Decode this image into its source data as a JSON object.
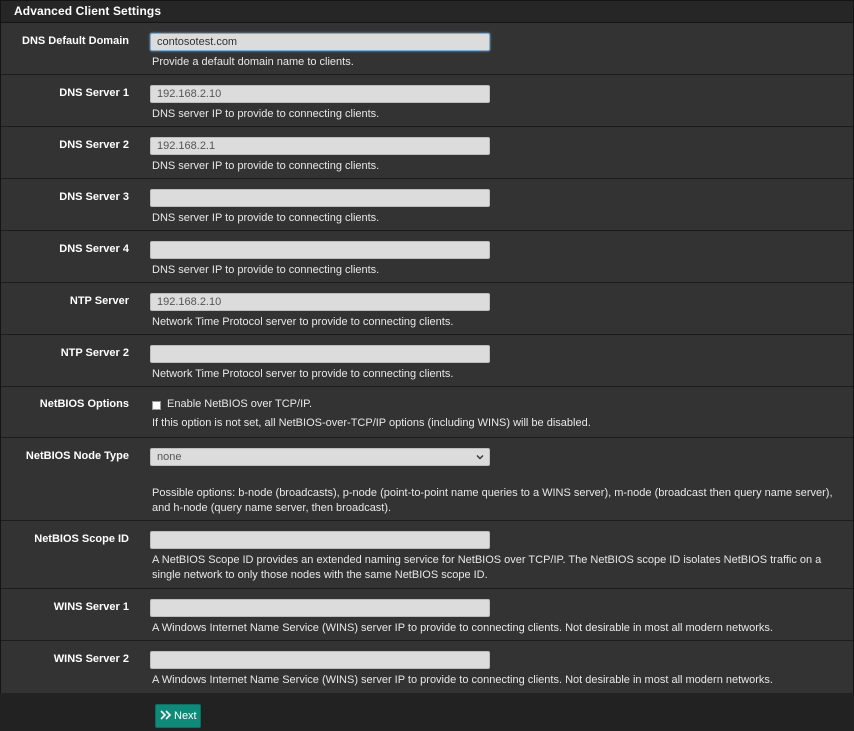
{
  "panel": {
    "title": "Advanced Client Settings"
  },
  "fields": {
    "dns_default_domain": {
      "label": "DNS Default Domain",
      "value": "contosotest.com",
      "help": "Provide a default domain name to clients."
    },
    "dns_server_1": {
      "label": "DNS Server 1",
      "value": "192.168.2.10",
      "help": "DNS server IP to provide to connecting clients."
    },
    "dns_server_2": {
      "label": "DNS Server 2",
      "value": "192.168.2.1",
      "help": "DNS server IP to provide to connecting clients."
    },
    "dns_server_3": {
      "label": "DNS Server 3",
      "value": "",
      "help": "DNS server IP to provide to connecting clients."
    },
    "dns_server_4": {
      "label": "DNS Server 4",
      "value": "",
      "help": "DNS server IP to provide to connecting clients."
    },
    "ntp_server": {
      "label": "NTP Server",
      "value": "192.168.2.10",
      "help": "Network Time Protocol server to provide to connecting clients."
    },
    "ntp_server_2": {
      "label": "NTP Server 2",
      "value": "",
      "help": "Network Time Protocol server to provide to connecting clients."
    },
    "netbios_options": {
      "label": "NetBIOS Options",
      "checkbox_label": "Enable NetBIOS over TCP/IP.",
      "checked": false,
      "help": "If this option is not set, all NetBIOS-over-TCP/IP options (including WINS) will be disabled."
    },
    "netbios_node_type": {
      "label": "NetBIOS Node Type",
      "selected": "none",
      "help": "Possible options: b-node (broadcasts), p-node (point-to-point name queries to a WINS server), m-node (broadcast then query name server), and h-node (query name server, then broadcast)."
    },
    "netbios_scope_id": {
      "label": "NetBIOS Scope ID",
      "value": "",
      "help": "A NetBIOS Scope ID provides an extended naming service for NetBIOS over TCP/IP. The NetBIOS scope ID isolates NetBIOS traffic on a single network to only those nodes with the same NetBIOS scope ID."
    },
    "wins_server_1": {
      "label": "WINS Server 1",
      "value": "",
      "help": "A Windows Internet Name Service (WINS) server IP to provide to connecting clients. Not desirable in most all modern networks."
    },
    "wins_server_2": {
      "label": "WINS Server 2",
      "value": "",
      "help": "A Windows Internet Name Service (WINS) server IP to provide to connecting clients. Not desirable in most all modern networks."
    }
  },
  "footer": {
    "next_label": "Next",
    "next_icon": "double-chevron-right-icon"
  },
  "colors": {
    "background": "#2a2a2a",
    "row_background": "#333333",
    "next_button": "#0f8a78"
  }
}
